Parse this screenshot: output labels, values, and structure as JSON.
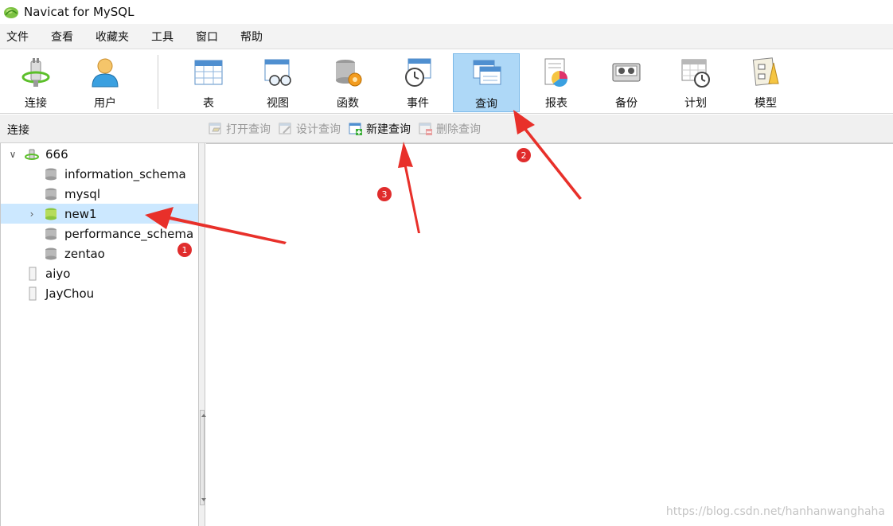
{
  "window": {
    "title": "Navicat for MySQL"
  },
  "menu": [
    {
      "label": "文件"
    },
    {
      "label": "查看"
    },
    {
      "label": "收藏夹"
    },
    {
      "label": "工具"
    },
    {
      "label": "窗口"
    },
    {
      "label": "帮助"
    }
  ],
  "toolbar": {
    "connect_label": "连接",
    "user_label": "用户",
    "table_label": "表",
    "view_label": "视图",
    "function_label": "函数",
    "event_label": "事件",
    "query_label": "查询",
    "report_label": "报表",
    "backup_label": "备份",
    "schedule_label": "计划",
    "model_label": "模型"
  },
  "subbar": {
    "connection_label": "连接",
    "open_query": "打开查询",
    "design_query": "设计查询",
    "new_query": "新建查询",
    "delete_query": "删除查询"
  },
  "tree": {
    "connection": "666",
    "databases": [
      "information_schema",
      "mysql",
      "new1",
      "performance_schema",
      "zentao"
    ],
    "other_connections": [
      "aiyo",
      "JayChou"
    ]
  },
  "annotations": {
    "badge1": "1",
    "badge2": "2",
    "badge3": "3"
  },
  "watermark": "https://blog.csdn.net/hanhanwanghaha",
  "colors": {
    "selected_row": "#cce8ff",
    "active_tool": "#aed8f7",
    "arrow": "#e8302a"
  }
}
